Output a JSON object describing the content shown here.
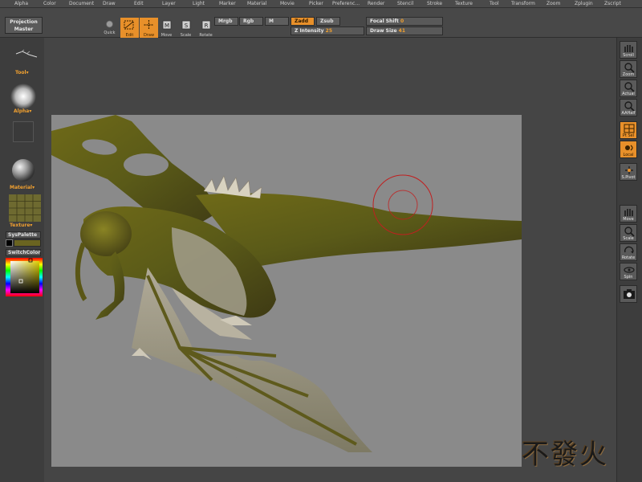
{
  "menu": [
    "Alpha",
    "Color",
    "Document",
    "Draw",
    "Edit",
    "Layer",
    "Light",
    "Marker",
    "Material",
    "Movie",
    "Picker",
    "Preferenc...",
    "Render",
    "Stencil",
    "Stroke",
    "Texture",
    "Tool",
    "Transform",
    "Zoom",
    "Zplugin",
    "Zscript"
  ],
  "toolbar": {
    "projection_master": "Projection Master",
    "quick": "Quick",
    "edit": "Edit",
    "draw": "Draw",
    "move": "Move",
    "scale": "Scale",
    "rotate": "Rotate",
    "mrgb": "Mrgb",
    "rgb": "Rgb",
    "m": "M",
    "zadd": "Zadd",
    "zsub": "Zsub",
    "z_intensity_label": "Z Intensity",
    "z_intensity_value": "25",
    "focal_shift_label": "Focal Shift",
    "focal_shift_value": "0",
    "draw_size_label": "Draw Size",
    "draw_size_value": "41"
  },
  "left": {
    "tool": "Tool",
    "alpha": "Alpha",
    "material": "Material",
    "texture": "Texture",
    "syspalette": "SysPalette",
    "switchcolor": "SwitchColor"
  },
  "right": {
    "scroll": "Scroll",
    "zoom": "Zoom",
    "actual": "Actual",
    "aahalf": "AAHalf",
    "persp": "Pt Sel",
    "local": "Local",
    "spivot": "S.Pivot",
    "move": "Move",
    "scale": "Scale",
    "rotate": "Rotate",
    "spin": "Spin"
  },
  "colors": {
    "accent": "#e8902a",
    "canvas": "#8a8a8a",
    "ui": "#484848"
  },
  "watermark": "不發火"
}
